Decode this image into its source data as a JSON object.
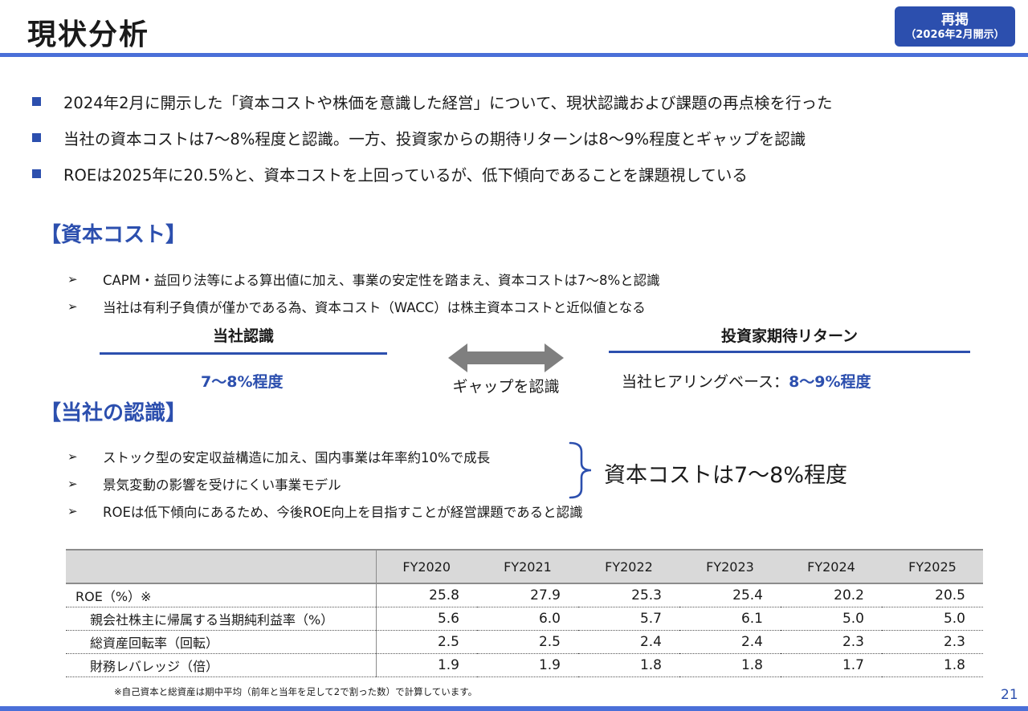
{
  "header": {
    "title": "現状分析",
    "badge_line1": "再掲",
    "badge_line2": "（2026年2月開示）"
  },
  "bullets": [
    "2024年2月に開示した「資本コストや株価を意識した経営」について、現状認識および課題の再点検を行った",
    "当社の資本コストは7〜8%程度と認識。一方、投資家からの期待リターンは8〜9%程度とギャップを認識",
    "ROEは2025年に20.5%と、資本コストを上回っているが、低下傾向であることを課題視している"
  ],
  "capital_cost_section": {
    "heading": "【資本コスト】",
    "arrow_symbol": "➢",
    "items": [
      "CAPM・益回り法等による算出値に加え、事業の安定性を踏まえ、資本コストは7〜8%と認識",
      "当社は有利子負債が僅かである為、資本コスト（WACC）は株主資本コストと近似値となる"
    ],
    "left_label": "当社認識",
    "left_value": "7〜8%程度",
    "gap_label": "ギャップを認識",
    "right_label": "投資家期待リターン",
    "right_prefix": "当社ヒアリングベース：",
    "right_value": "8〜9%程度"
  },
  "recognition_section": {
    "heading": "【当社の認識】",
    "items": [
      "ストック型の安定収益構造に加え、国内事業は年率約10%で成長",
      "景気変動の影響を受けにくい事業モデル",
      "ROEは低下傾向にあるため、今後ROE向上を目指すことが経営課題であると認識"
    ],
    "brace_conclusion": "資本コストは7〜8%程度"
  },
  "table": {
    "columns": [
      "FY2020",
      "FY2021",
      "FY2022",
      "FY2023",
      "FY2024",
      "FY2025"
    ],
    "rows": [
      {
        "label": "ROE（%）※",
        "values": [
          "25.8",
          "27.9",
          "25.3",
          "25.4",
          "20.2",
          "20.5"
        ]
      },
      {
        "label": "親会社株主に帰属する当期純利益率（%）",
        "values": [
          "5.6",
          "6.0",
          "5.7",
          "6.1",
          "5.0",
          "5.0"
        ]
      },
      {
        "label": "総資産回転率（回転）",
        "values": [
          "2.5",
          "2.5",
          "2.4",
          "2.4",
          "2.3",
          "2.3"
        ]
      },
      {
        "label": "財務レバレッジ（倍）",
        "values": [
          "1.9",
          "1.9",
          "1.8",
          "1.8",
          "1.7",
          "1.8"
        ]
      }
    ],
    "footnote": "※自己資本と総資産は期中平均（前年と当年を足して2で割った数）で計算しています。"
  },
  "page_number": "21"
}
